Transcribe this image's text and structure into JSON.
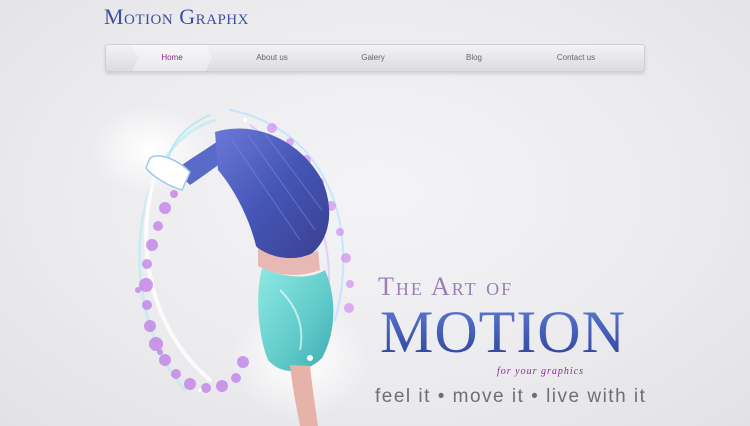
{
  "site": {
    "logo_text": "Motion Graphx"
  },
  "nav": {
    "items": [
      {
        "label": "Home",
        "active": true
      },
      {
        "label": "About us",
        "active": false
      },
      {
        "label": "Galery",
        "active": false
      },
      {
        "label": "Blog",
        "active": false
      },
      {
        "label": "Contact us",
        "active": false
      }
    ]
  },
  "hero": {
    "headline_small": "The Art of",
    "headline_big": "MOTION",
    "tagline": "for your graphics",
    "slogan": "feel it • move it • live with it"
  },
  "colors": {
    "accent_purple": "#8a2a7f",
    "logo_blue": "#3d4f9c",
    "motion_blue": "#3f5db8"
  }
}
